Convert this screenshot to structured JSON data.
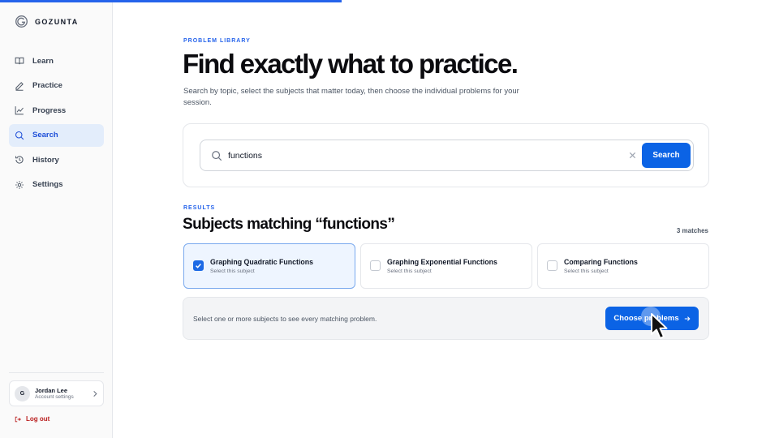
{
  "brand": {
    "name": "GOZUNTA"
  },
  "nav": {
    "items": [
      {
        "label": "Learn",
        "icon": "book-icon"
      },
      {
        "label": "Practice",
        "icon": "pencil-icon"
      },
      {
        "label": "Progress",
        "icon": "chart-icon"
      },
      {
        "label": "Search",
        "icon": "search-icon",
        "active": true
      },
      {
        "label": "History",
        "icon": "history-icon"
      },
      {
        "label": "Settings",
        "icon": "gear-icon"
      }
    ]
  },
  "user": {
    "initial": "G",
    "name": "Jordan Lee",
    "subtitle": "Account settings"
  },
  "logout_label": "Log out",
  "hero": {
    "eyebrow": "PROBLEM LIBRARY",
    "title": "Find exactly what to practice.",
    "description": "Search by topic, select the subjects that matter today, then choose the individual problems for your session."
  },
  "search": {
    "value": "functions",
    "button_label": "Search"
  },
  "results": {
    "eyebrow": "RESULTS",
    "title": "Subjects matching “functions”",
    "count_label": "3 matches",
    "cards": [
      {
        "title": "Graphing Quadratic Functions",
        "subtitle": "Select this subject",
        "checked": true
      },
      {
        "title": "Graphing Exponential Functions",
        "subtitle": "Select this subject",
        "checked": false
      },
      {
        "title": "Comparing Functions",
        "subtitle": "Select this subject",
        "checked": false
      }
    ]
  },
  "action": {
    "hint": "Select one or more subjects to see every matching problem.",
    "button_label": "Choose problems"
  },
  "colors": {
    "accent": "#0b63e5",
    "active_nav_bg": "#e3edfb",
    "logout": "#b91c1c"
  }
}
